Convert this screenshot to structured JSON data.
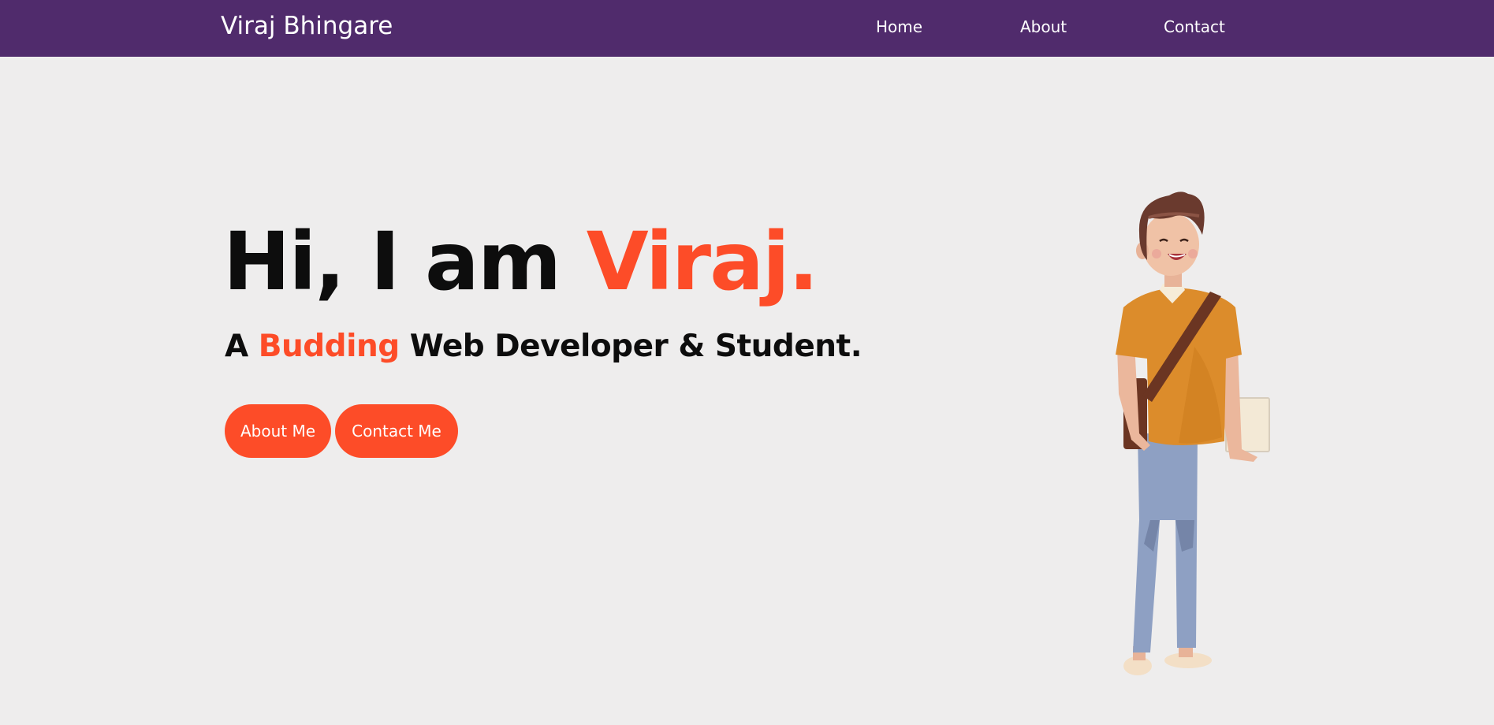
{
  "nav": {
    "brand": "Viraj Bhingare",
    "links": [
      "Home",
      "About",
      "Contact"
    ],
    "background_color": "#502b6c"
  },
  "hero": {
    "greeting": "Hi, I am ",
    "name": "Viraj.",
    "subtitle_prefix": "A ",
    "subtitle_accent": "Budding",
    "subtitle_rest": " Web Developer & Student.",
    "buttons": {
      "about": "About Me",
      "contact": "Contact Me"
    },
    "accent_color": "#fd4c28"
  },
  "illustration": {
    "icon": "student-character-illustration"
  },
  "page": {
    "background_color": "#eeeded"
  }
}
